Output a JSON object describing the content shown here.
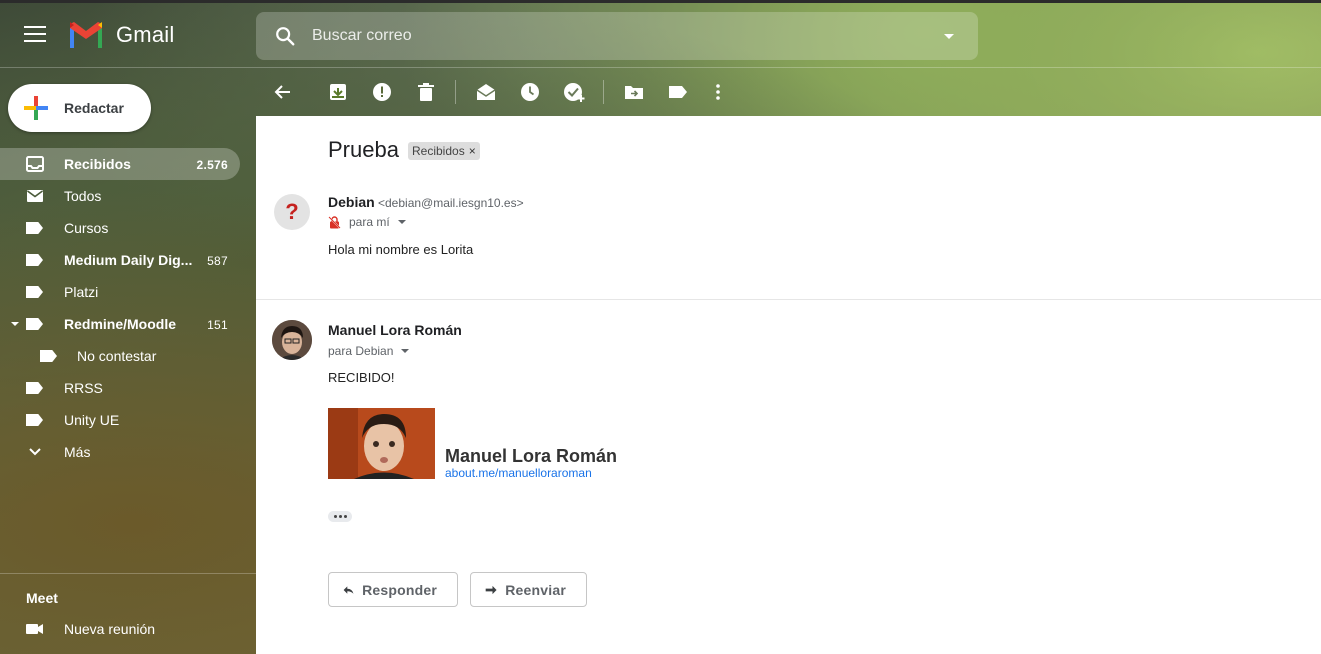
{
  "app": {
    "name": "Gmail"
  },
  "search": {
    "placeholder": "Buscar correo"
  },
  "compose": {
    "label": "Redactar"
  },
  "sidebar": {
    "items": [
      {
        "label": "Recibidos",
        "count": "2.576",
        "icon": "inbox-icon",
        "active": true
      },
      {
        "label": "Todos",
        "count": "",
        "icon": "mail-icon"
      },
      {
        "label": "Cursos",
        "count": "",
        "icon": "label-icon"
      },
      {
        "label": "Medium Daily Dig...",
        "count": "587",
        "icon": "label-icon"
      },
      {
        "label": "Platzi",
        "count": "",
        "icon": "label-icon"
      },
      {
        "label": "Redmine/Moodle",
        "count": "151",
        "icon": "label-icon"
      },
      {
        "label": "No contestar",
        "count": "",
        "icon": "label-icon"
      },
      {
        "label": "RRSS",
        "count": "",
        "icon": "label-icon"
      },
      {
        "label": "Unity UE",
        "count": "",
        "icon": "label-icon"
      },
      {
        "label": "Más",
        "count": "",
        "icon": "chevron-down-icon"
      }
    ]
  },
  "meet": {
    "title": "Meet",
    "new_meeting": "Nueva reunión"
  },
  "toolbar": {
    "icons": [
      "back-arrow-icon",
      "archive-icon",
      "report-spam-icon",
      "delete-icon",
      "mark-unread-icon",
      "snooze-icon",
      "add-task-icon",
      "move-to-icon",
      "labels-icon",
      "more-vert-icon"
    ]
  },
  "thread": {
    "subject": "Prueba",
    "label_tag": "Recibidos",
    "label_remove": "×",
    "messages": [
      {
        "sender_name": "Debian",
        "sender_email": "<debian@mail.iesgn10.es>",
        "to": "para mí",
        "avatar_glyph": "?",
        "body": "Hola mi nombre es Lorita"
      },
      {
        "sender_name": "Manuel Lora Román",
        "to": "para Debian",
        "body": "RECIBIDO!",
        "signature": {
          "name": "Manuel Lora Román",
          "link": "about.me/manuelloraroman"
        }
      }
    ]
  },
  "actions": {
    "reply": "Responder",
    "forward": "Reenviar"
  },
  "colors": {
    "gmail_red": "#EA4335",
    "gmail_blue": "#4285F4",
    "gmail_green": "#34A853",
    "gmail_yellow": "#FBBC04",
    "link": "#1a73e8"
  }
}
